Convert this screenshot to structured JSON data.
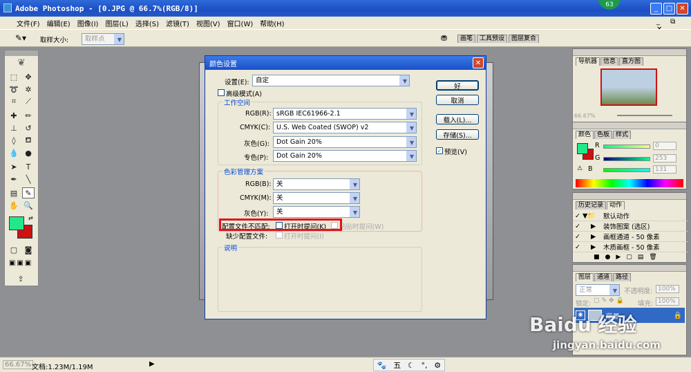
{
  "window": {
    "title": "Adobe Photoshop - [0.JPG @ 66.7%(RGB/8)]",
    "badge": "63"
  },
  "menu": [
    "文件(F)",
    "编辑(E)",
    "图像(I)",
    "图层(L)",
    "选择(S)",
    "滤镜(T)",
    "视图(V)",
    "窗口(W)",
    "帮助(H)"
  ],
  "options": {
    "sample_label": "取样大小:",
    "sample_value": "取样点",
    "tabs": [
      "画笔",
      "工具预设",
      "图层复合"
    ]
  },
  "dialog": {
    "title": "颜色设置",
    "settings_label": "设置(E):",
    "settings_value": "自定",
    "advanced_label": "高级模式(A)",
    "workspace_title": "工作空间",
    "workspace": [
      {
        "label": "RGB(R):",
        "value": "sRGB IEC61966-2.1"
      },
      {
        "label": "CMYK(C):",
        "value": "U.S. Web Coated (SWOP) v2"
      },
      {
        "label": "灰色(G):",
        "value": "Dot Gain 20%"
      },
      {
        "label": "专色(P):",
        "value": "Dot Gain 20%"
      }
    ],
    "policy_title": "色彩管理方案",
    "policy": [
      {
        "label": "RGB(B):",
        "value": "关"
      },
      {
        "label": "CMYK(M):",
        "value": "关"
      },
      {
        "label": "灰色(Y):",
        "value": "关"
      }
    ],
    "mismatch_label": "配置文件不匹配:",
    "mismatch_ask_open": "打开时提问(K)",
    "mismatch_ask_paste": "粘贴时提问(W)",
    "missing_label": "缺少配置文件:",
    "missing_ask_open": "打开时提问(I)",
    "desc_title": "说明",
    "buttons": {
      "ok": "好",
      "cancel": "取消",
      "load": "载入(L)...",
      "save": "存储(S)..."
    },
    "preview_label": "预览(V)",
    "highlight_color": "#e0131b"
  },
  "navigator": {
    "tabs": [
      "导航器",
      "信息",
      "直方图"
    ],
    "zoom": "66.67%"
  },
  "color_panel": {
    "tabs": [
      "颜色",
      "色板",
      "样式"
    ],
    "r_label": "R",
    "g_label": "G",
    "b_label": "B",
    "r": "0",
    "g": "253",
    "b": "131",
    "fg_color": "#22e88a",
    "bg_color": "#cc1111"
  },
  "history": {
    "tabs": [
      "历史记录",
      "动作"
    ],
    "items": [
      "默认动作",
      "装饰图案 (选区)",
      "画框通道 - 50 像素",
      "木质画框 - 50 像素"
    ]
  },
  "layers": {
    "tabs": [
      "图层",
      "通道",
      "路径"
    ],
    "mode": "正常",
    "opacity_label": "不透明度:",
    "opacity": "100%",
    "lock_label": "锁定:",
    "fill_label": "填充:",
    "fill": "100%",
    "layer_name": "背景"
  },
  "status": {
    "zoom": "66.67%",
    "doc": "文档:1.23M/1.19M"
  },
  "tray": [
    "五"
  ],
  "watermark": {
    "brand": "Baidu 经验",
    "url": "jingyan.baidu.com"
  }
}
